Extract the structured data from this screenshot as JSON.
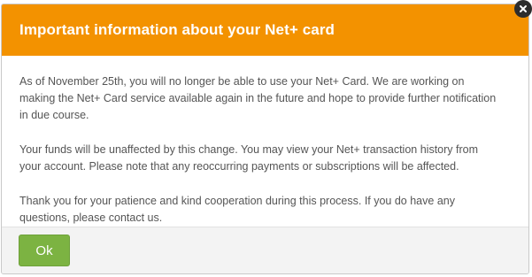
{
  "dialog": {
    "title": "Important information about your Net+ card",
    "paragraphs": [
      "As of November 25th, you will no longer be able to use your Net+ Card. We are working on making the Net+ Card service available again in the future and hope to provide further notification in due course.",
      "Your funds will be unaffected by this change. You may view your Net+ transaction history from your account. Please note that any reoccurring payments or subscriptions will be affected.",
      "Thank you for your patience and kind cooperation during this process. If you do have any questions, please contact us."
    ],
    "ok_label": "Ok",
    "close_icon": "close-icon"
  },
  "colors": {
    "header_bg": "#f39200",
    "ok_button_bg": "#7cb342",
    "body_text": "#555555",
    "footer_bg": "#f3f3f3"
  }
}
